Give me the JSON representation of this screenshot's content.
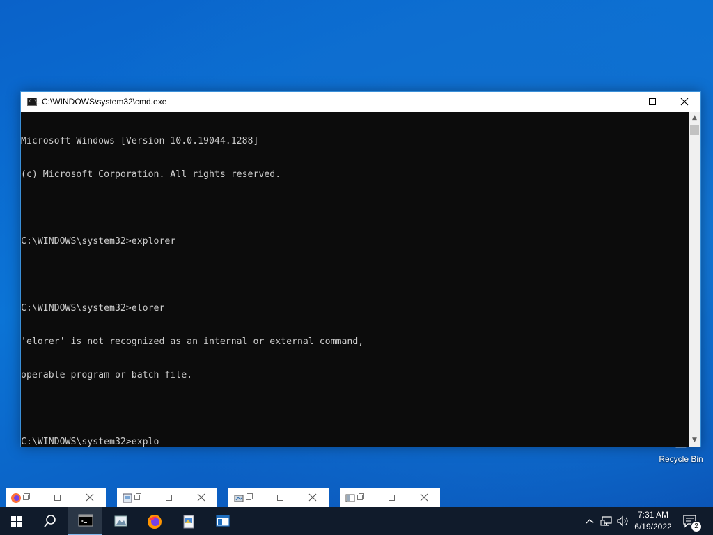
{
  "desktop": {
    "recycle_bin_label": "Recycle Bin"
  },
  "window": {
    "title": "C:\\WINDOWS\\system32\\cmd.exe",
    "console_lines": [
      "Microsoft Windows [Version 10.0.19044.1288]",
      "(c) Microsoft Corporation. All rights reserved.",
      "",
      "C:\\WINDOWS\\system32>explorer",
      "",
      "C:\\WINDOWS\\system32>elorer",
      "'elorer' is not recognized as an internal or external command,",
      "operable program or batch file.",
      "",
      "C:\\WINDOWS\\system32>explo"
    ],
    "colors": {
      "console_bg": "#0c0c0c",
      "console_text": "#cccccc"
    }
  },
  "thumbnails": [
    {
      "icon": "firefox-icon"
    },
    {
      "icon": "notepad-icon"
    },
    {
      "icon": "network-icon"
    },
    {
      "icon": "window-icon"
    }
  ],
  "taskbar": {
    "buttons": [
      {
        "icon": "start-icon"
      },
      {
        "icon": "search-icon"
      },
      {
        "icon": "cmd-icon",
        "active": true
      },
      {
        "icon": "photo-viewer-icon"
      },
      {
        "icon": "firefox-icon"
      },
      {
        "icon": "paint-icon"
      },
      {
        "icon": "app-window-icon"
      }
    ],
    "tray": {
      "time": "7:31 AM",
      "date": "6/19/2022",
      "notification_count": "2"
    },
    "colors": {
      "background": "#101b2b",
      "active_indicator": "#7fb6ea"
    }
  }
}
